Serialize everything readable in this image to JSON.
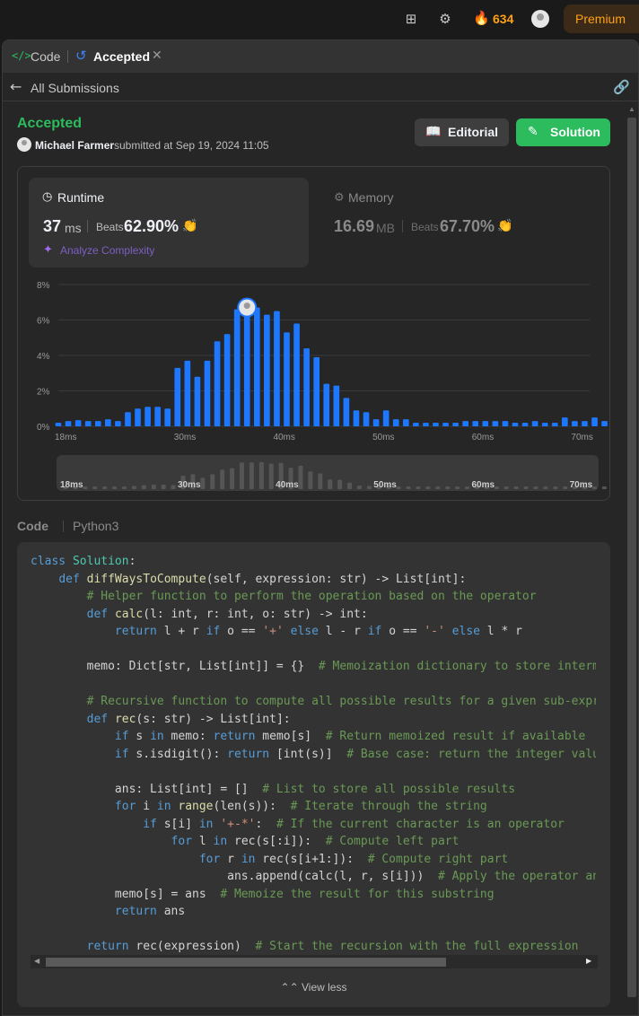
{
  "topbar": {
    "streak_count": "634",
    "premium_label": "Premium",
    "icons": [
      "layout-grid-icon",
      "gear-icon",
      "fire-icon",
      "avatar"
    ]
  },
  "tabs": {
    "code_label": "Code",
    "accepted_label": "Accepted"
  },
  "subbar": {
    "all_submissions": "All Submissions"
  },
  "submission": {
    "status": "Accepted",
    "user": "Michael Farmer",
    "submitted_at": "submitted at Sep 19, 2024 11:05",
    "editorial_label": "Editorial",
    "solution_label": "Solution"
  },
  "runtime": {
    "title": "Runtime",
    "value": "37",
    "unit": "ms",
    "beats_label": "Beats",
    "beats_pct": "62.90%",
    "analyze_label": "Analyze Complexity"
  },
  "memory": {
    "title": "Memory",
    "value": "16.69",
    "unit": "MB",
    "beats_label": "Beats",
    "beats_pct": "67.70%"
  },
  "chart_data": {
    "type": "bar",
    "title": "",
    "xlabel": "",
    "ylabel": "",
    "x_unit": "ms",
    "y_unit": "%",
    "ylim": [
      0,
      8
    ],
    "y_ticks": [
      "0%",
      "2%",
      "4%",
      "6%",
      "8%"
    ],
    "x_ticks": [
      {
        "label": "18ms",
        "value": 18
      },
      {
        "label": "30ms",
        "value": 30
      },
      {
        "label": "40ms",
        "value": 40
      },
      {
        "label": "50ms",
        "value": 50
      },
      {
        "label": "60ms",
        "value": 60
      },
      {
        "label": "70ms",
        "value": 70
      }
    ],
    "x": [
      18,
      19,
      20,
      21,
      22,
      23,
      24,
      25,
      26,
      27,
      28,
      29,
      30,
      31,
      32,
      33,
      34,
      35,
      36,
      37,
      38,
      39,
      40,
      41,
      42,
      43,
      44,
      45,
      46,
      47,
      48,
      49,
      50,
      51,
      52,
      53,
      54,
      55,
      56,
      57,
      58,
      59,
      60,
      61,
      62,
      63,
      64,
      65,
      66,
      67,
      68,
      69,
      70,
      71
    ],
    "values": [
      0.2,
      0.3,
      0.35,
      0.3,
      0.3,
      0.4,
      0.3,
      0.8,
      1.0,
      1.1,
      1.1,
      1.0,
      3.3,
      3.7,
      2.8,
      3.7,
      4.8,
      5.2,
      6.6,
      6.6,
      6.7,
      6.3,
      6.5,
      5.3,
      5.8,
      4.4,
      3.9,
      2.4,
      2.3,
      1.6,
      0.9,
      0.8,
      0.4,
      0.9,
      0.4,
      0.4,
      0.2,
      0.2,
      0.2,
      0.2,
      0.2,
      0.3,
      0.3,
      0.3,
      0.3,
      0.3,
      0.2,
      0.2,
      0.3,
      0.2,
      0.2,
      0.5,
      0.3,
      0.3,
      0.5,
      0.3
    ],
    "highlight_x": 37,
    "grid": true,
    "bar_color": "#1e78ff",
    "grid_color": "#3a3a3a"
  },
  "code": {
    "label": "Code",
    "language": "Python3",
    "view_less_label": "View less"
  },
  "colors": {
    "accent_green": "#2cbb5d",
    "accent_orange": "#ffa116",
    "accent_blue": "#1e78ff"
  }
}
